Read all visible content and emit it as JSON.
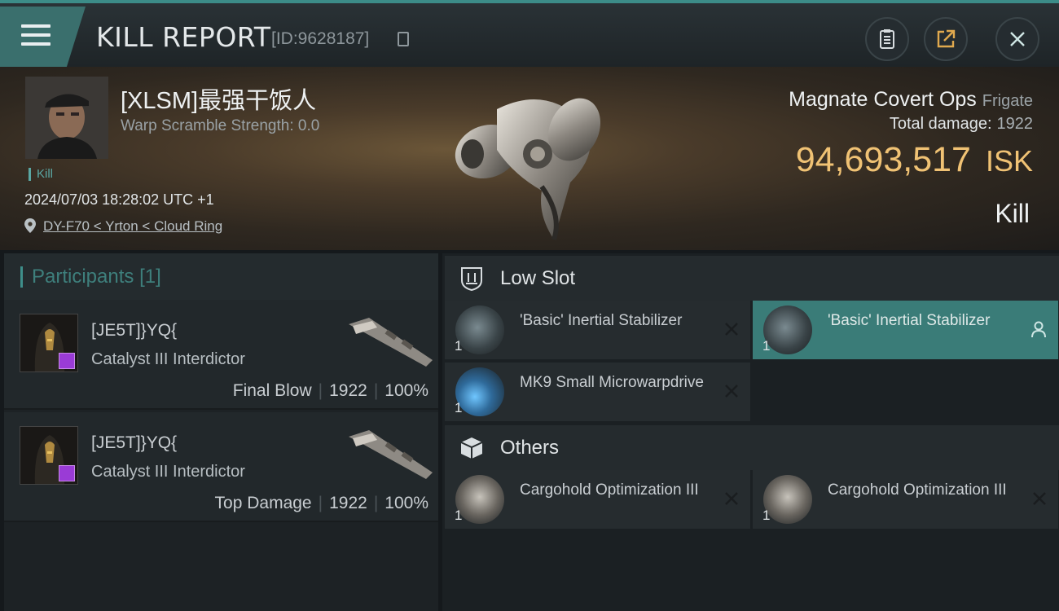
{
  "header": {
    "title": "KILL REPORT",
    "report_id": "[ID:9628187]"
  },
  "victim": {
    "name": "[XLSM]最强干饭人",
    "warp_scramble": "Warp Scramble Strength: 0.0",
    "tag": "Kill",
    "datetime": "2024/07/03 18:28:02 UTC +1",
    "location": "DY-F70 < Yrton < Cloud Ring"
  },
  "ship": {
    "name": "Magnate Covert Ops",
    "class": "Frigate",
    "total_damage_label": "Total damage:",
    "total_damage": "1922",
    "value": "94,693,517",
    "currency": "ISK",
    "result": "Kill"
  },
  "participants": {
    "title": "Participants",
    "count": "[1]",
    "rows": [
      {
        "name": "[JE5T]}YQ{",
        "ship": "Catalyst III Interdictor",
        "role": "Final Blow",
        "damage": "1922",
        "percent": "100%"
      },
      {
        "name": "[JE5T]}YQ{",
        "ship": "Catalyst III Interdictor",
        "role": "Top Damage",
        "damage": "1922",
        "percent": "100%"
      }
    ]
  },
  "fitting": {
    "low_slot_title": "Low Slot",
    "others_title": "Others",
    "modules": [
      {
        "name": "'Basic' Inertial Stabilizer",
        "qty": "1"
      },
      {
        "name": "'Basic' Inertial Stabilizer",
        "qty": "1"
      },
      {
        "name": "MK9 Small Microwarpdrive",
        "qty": "1"
      },
      {
        "name": "Cargohold Optimization III",
        "qty": "1"
      },
      {
        "name": "Cargohold Optimization III",
        "qty": "1"
      }
    ]
  },
  "colors": {
    "accent_teal": "#3a7c78",
    "isk_gold": "#f0c274",
    "badge_purple": "#9a3bd6"
  }
}
